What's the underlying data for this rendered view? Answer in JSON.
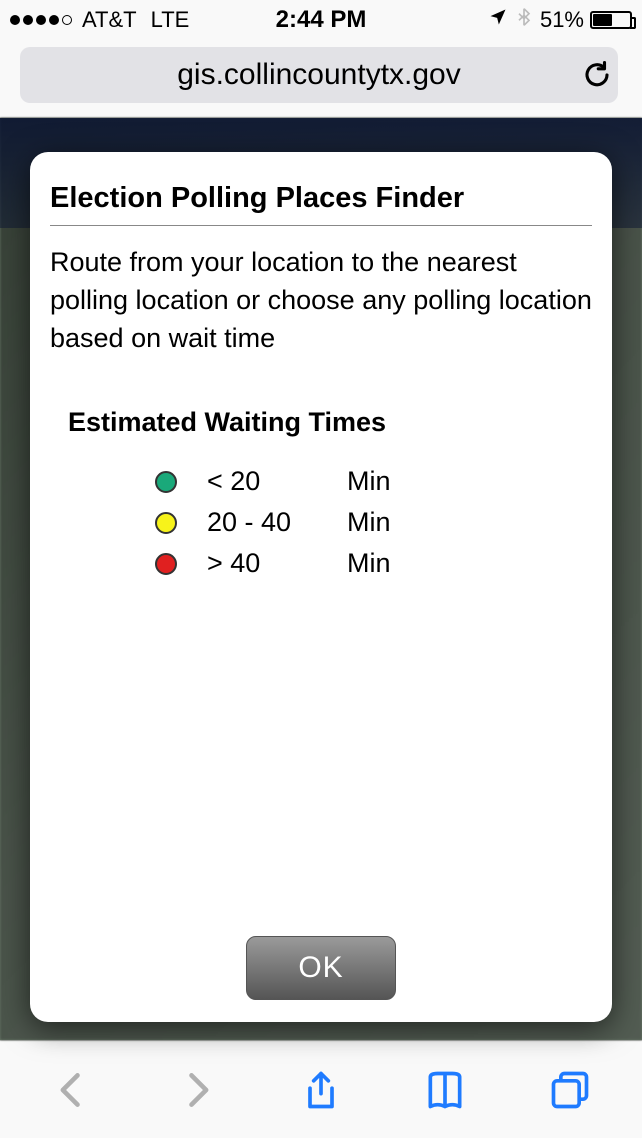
{
  "statusbar": {
    "carrier": "AT&T",
    "network": "LTE",
    "time": "2:44 PM",
    "battery_pct": "51%"
  },
  "addressbar": {
    "url": "gis.collincountytx.gov"
  },
  "dialog": {
    "title": "Election Polling Places Finder",
    "description": "Route from your location to the nearest polling location or choose any polling location based on wait time",
    "legend_title": "Estimated Waiting Times",
    "legend": [
      {
        "color": "#1aa97a",
        "range": "< 20",
        "unit": "Min"
      },
      {
        "color": "#f7f31a",
        "range": "20 - 40",
        "unit": "Min"
      },
      {
        "color": "#e02020",
        "range": "> 40",
        "unit": "Min"
      }
    ],
    "ok_label": "OK"
  },
  "icons": {
    "location": "location-arrow",
    "bluetooth": "bluetooth",
    "refresh": "refresh",
    "back": "chevron-left",
    "forward": "chevron-right",
    "share": "share",
    "bookmarks": "book",
    "tabs": "tabs"
  }
}
